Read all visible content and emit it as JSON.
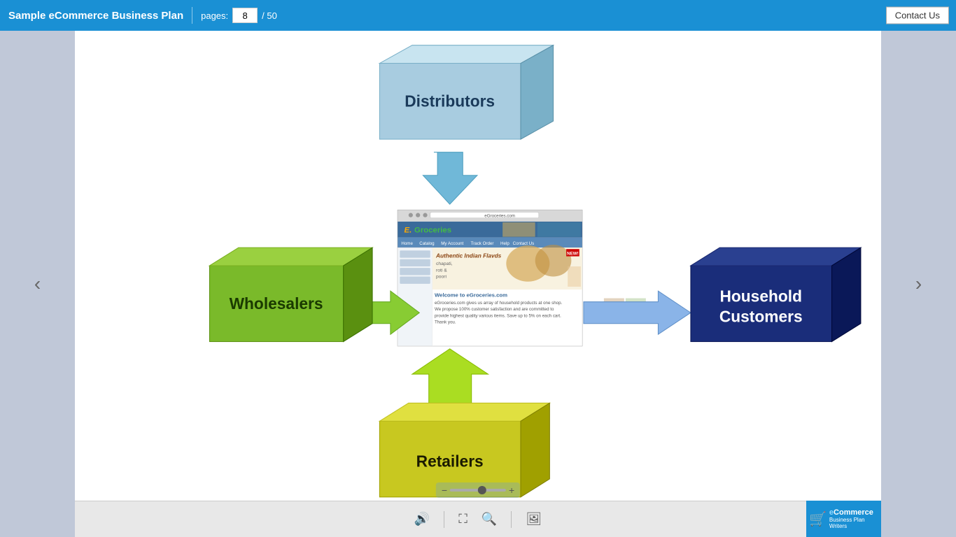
{
  "header": {
    "title": "Sample eCommerce Business Plan",
    "pages_label": "pages:",
    "current_page": "8",
    "total_pages": "/ 50",
    "contact_btn": "Contact Us"
  },
  "nav": {
    "prev": "‹",
    "next": "›"
  },
  "diagram": {
    "distributors": "Distributors",
    "wholesalers": "Wholesalers",
    "household": "Household Customers",
    "retailers": "Retailers"
  },
  "website": {
    "url": "eGroceries.com",
    "logo_e": "E.",
    "logo_name": "Groceries",
    "nav_items": [
      "Home",
      "Catalog",
      "My Account",
      "Track Order",
      "Help",
      "Contact Us"
    ],
    "banner_title": "Authentic Indian Flavds",
    "banner_subtitle": "chapati, roti & poori",
    "welcome_text": "Welcome to eGroceries.com",
    "desc": "eGroceries.com gives us array of household products at one shop. We propose 100% customer satisfaction and are committed to provide highest quality various items. Save up to 5% on each cart visit."
  },
  "toolbar": {
    "sound_icon": "🔊",
    "fullscreen_icon": "⛶",
    "zoom_out_icon": "🔍",
    "gallery_icon": "🖼",
    "zoom_minus": "−",
    "zoom_plus": "+"
  },
  "brand": {
    "line1": "eCommerce",
    "line2": "Business Plan Writers"
  },
  "colors": {
    "header_bg": "#1a90d4",
    "distributors_front": "#a8cce0",
    "distributors_top": "#c8e4f0",
    "distributors_side": "#7ab0c8",
    "wholesalers_front": "#7aba2a",
    "wholesalers_top": "#9ad040",
    "wholesalers_side": "#5a9010",
    "household_front": "#1a2d7a",
    "household_top": "#2a4090",
    "household_side": "#0a1858",
    "retailers_front": "#c8c820",
    "retailers_top": "#e0e040",
    "retailers_side": "#a0a000",
    "arrow_blue_down": "#60b0d8",
    "arrow_green_right": "#88cc33",
    "arrow_blue_right": "#8ab4e8",
    "arrow_green_up": "#aadd22"
  }
}
